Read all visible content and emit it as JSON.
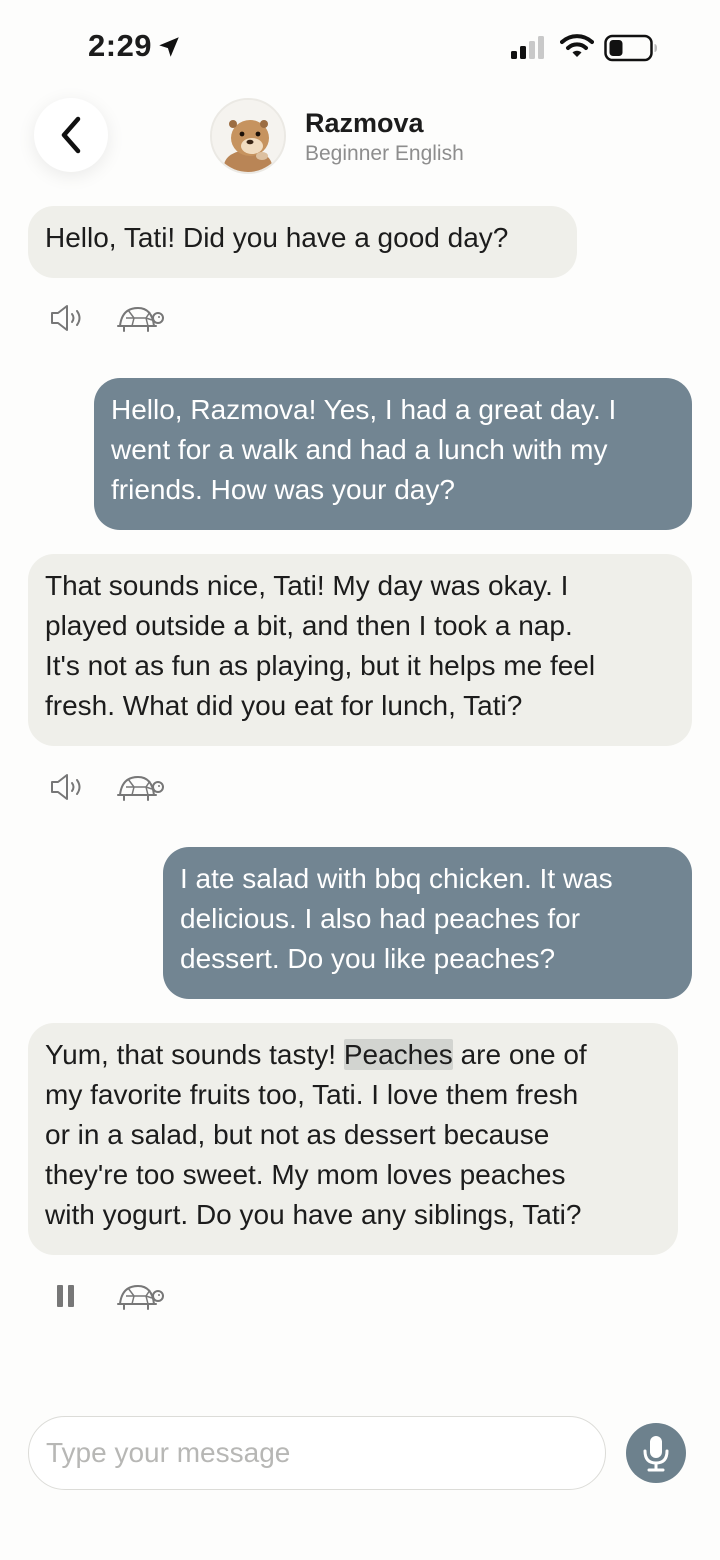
{
  "status_bar": {
    "time": "2:29"
  },
  "header": {
    "title": "Razmova",
    "subtitle": "Beginner English"
  },
  "messages": [
    {
      "sender": "bot",
      "lines": [
        "Hello, Tati! Did you have a good day?"
      ]
    },
    {
      "sender": "user",
      "lines": [
        "Hello, Razmova! Yes, I had a great day. I",
        "went for a walk and had a lunch with my",
        "friends. How was your day?"
      ]
    },
    {
      "sender": "bot",
      "lines": [
        "That sounds nice, Tati! My day was okay. I",
        "played outside a bit, and then I took a nap.",
        "It's not as fun as playing, but it helps me feel",
        "fresh. What did you eat for lunch, Tati?"
      ]
    },
    {
      "sender": "user",
      "lines": [
        "I ate salad with bbq chicken. It was",
        "delicious. I also had peaches for",
        "dessert. Do you like peaches?"
      ]
    },
    {
      "sender": "bot",
      "line1_pre": "Yum, that sounds tasty! ",
      "line1_highlight": "Peaches",
      "line1_post": " are one of",
      "lines": [
        "my favorite fruits too, Tati. I love them fresh",
        "or in a salad, but not as dessert because",
        "they're too sweet. My mom loves peaches",
        "with yogurt. Do you have any siblings, Tati?"
      ],
      "highlighted_word": "Peaches"
    }
  ],
  "icons": {
    "back": "chevron-left-icon",
    "speaker": "speaker-icon",
    "turtle": "turtle-icon",
    "pause": "pause-icon",
    "mic": "microphone-icon",
    "location": "location-arrow-icon",
    "signal": "cellular-signal-icon",
    "wifi": "wifi-icon",
    "battery": "battery-icon"
  },
  "input": {
    "placeholder": "Type your message",
    "value": ""
  },
  "colors": {
    "bot_bubble": "#efefea",
    "user_bubble": "#728592",
    "mic_button": "#6d818d",
    "highlight": "#d2d4d0"
  }
}
